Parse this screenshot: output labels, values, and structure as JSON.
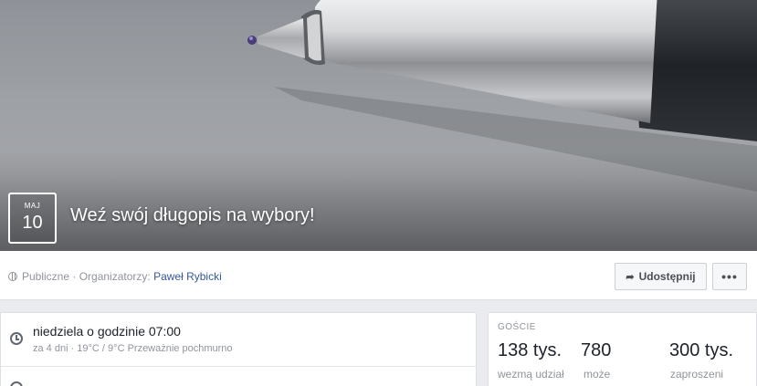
{
  "event": {
    "month": "MAJ",
    "day": "10",
    "title": "Weź swój długopis na wybory!"
  },
  "info": {
    "privacy": "Publiczne",
    "separator": " · ",
    "organizers_label": "Organizatorzy: ",
    "organizer_name": "Paweł Rybicki"
  },
  "actions": {
    "share_label": "Udostępnij",
    "more_label": "•••"
  },
  "details": {
    "when_main": "niedziela o godzinie 07:00",
    "when_sub": "za 4 dni · 19°C / 9°C Przeważnie pochmurno"
  },
  "guests": {
    "title": "GOŚCIE",
    "going_count": "138 tys.",
    "going_label": "wezmą udział",
    "maybe_count": "780",
    "maybe_label": "może",
    "invited_count": "300 tys.",
    "invited_label": "zaproszeni"
  }
}
